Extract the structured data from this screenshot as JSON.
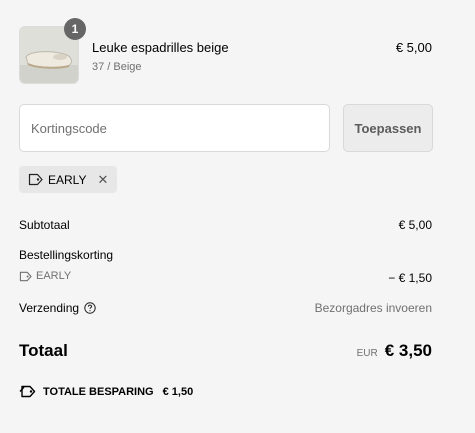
{
  "product": {
    "quantity": "1",
    "name": "Leuke espadrilles beige",
    "variant": "37 / Beige",
    "price": "€ 5,00"
  },
  "discount": {
    "placeholder": "Kortingscode",
    "apply_label": "Toepassen",
    "applied_code": "EARLY"
  },
  "summary": {
    "subtotal_label": "Subtotaal",
    "subtotal_value": "€ 5,00",
    "order_discount_label": "Bestellingskorting",
    "order_discount_code": "EARLY",
    "order_discount_value": "− € 1,50",
    "shipping_label": "Verzending",
    "shipping_value": "Bezorgadres invoeren",
    "total_label": "Totaal",
    "total_currency": "EUR",
    "total_value": "€ 3,50",
    "savings_label": "TOTALE BESPARING",
    "savings_value": "€ 1,50"
  },
  "icons": {
    "tag": "tag-icon",
    "help": "question-circle-icon",
    "close": "close-icon",
    "savings": "tags-icon"
  },
  "colors": {
    "background": "#f5f5f5",
    "muted_text": "#707070",
    "badge": "#666666",
    "chip": "#e7e7e7",
    "apply_button": "#ececec"
  }
}
